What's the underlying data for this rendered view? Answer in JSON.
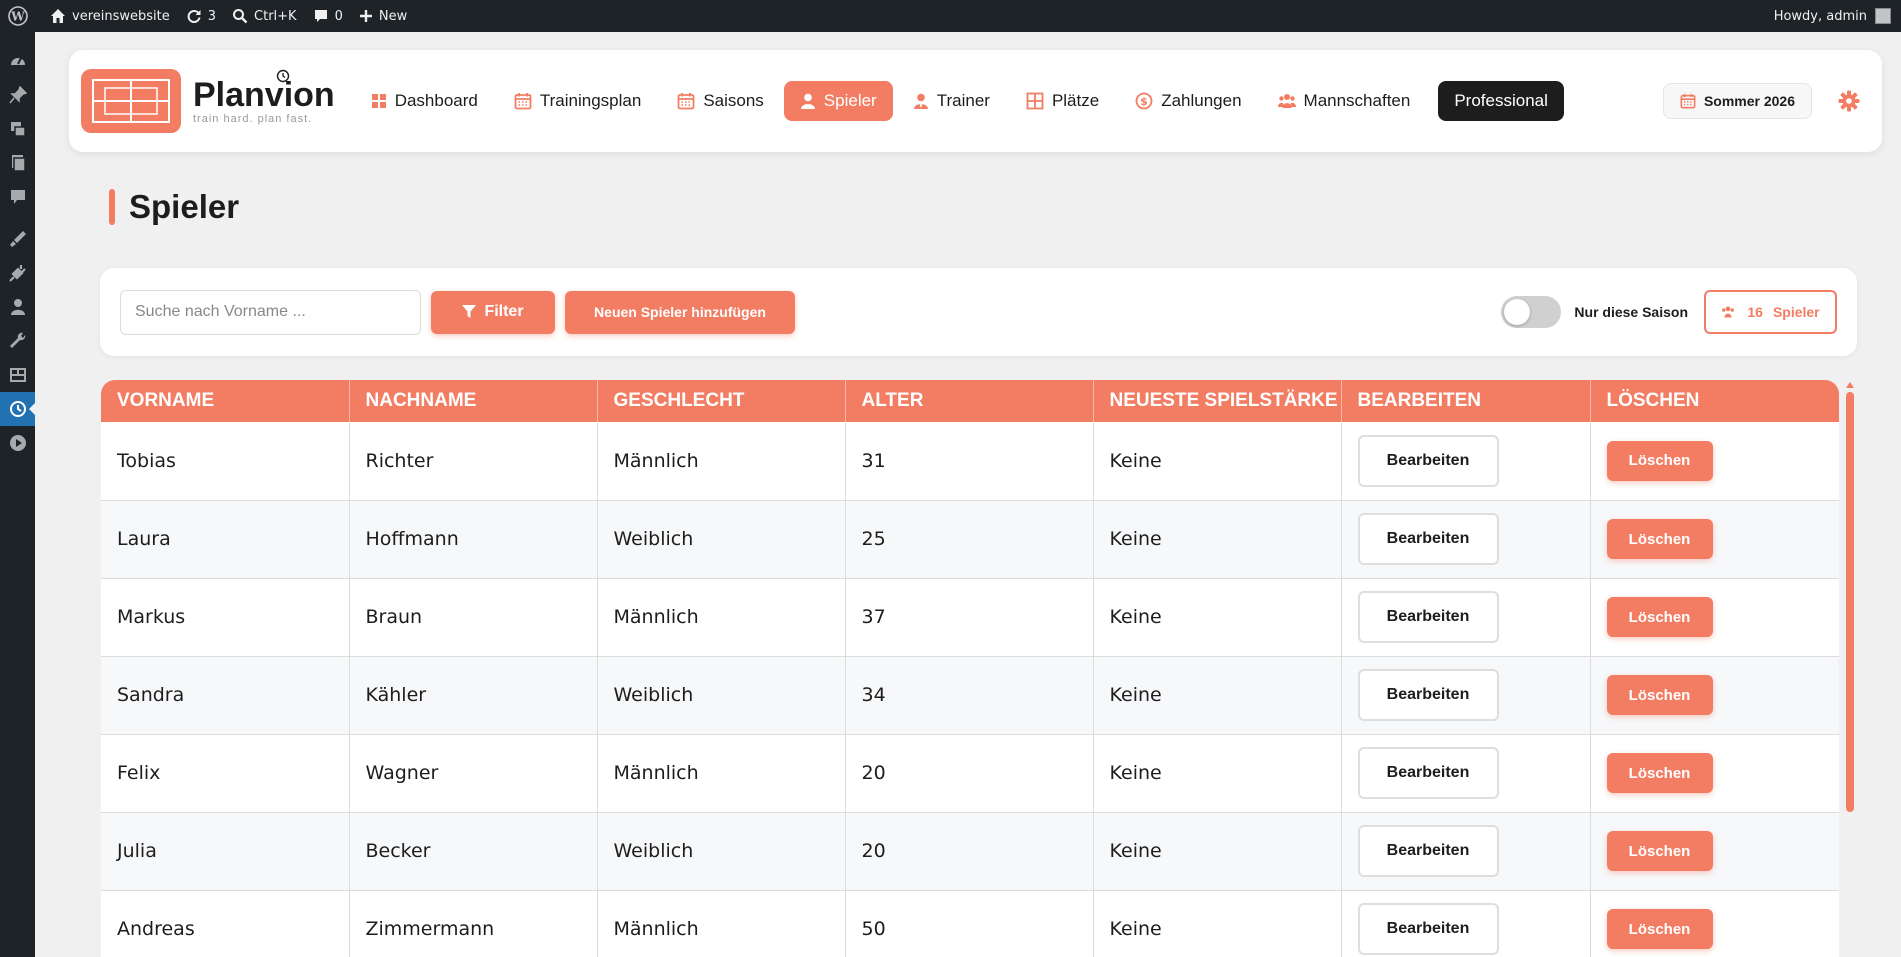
{
  "adminbar": {
    "site_name": "vereinswebsite",
    "updates_count": "3",
    "search_shortcut": "Ctrl+K",
    "comments_count": "0",
    "new_label": "New",
    "howdy": "Howdy, admin"
  },
  "adminmenu": {
    "icons": [
      "dashboard-icon",
      "pin-icon",
      "media-icon",
      "pages-icon",
      "comments-icon",
      "appearance-icon",
      "plugins-icon",
      "users-icon",
      "tools-icon",
      "settings-icon",
      "planvion-icon",
      "play-icon"
    ]
  },
  "app": {
    "brand_name": "Planvion",
    "brand_tagline": "train hard. plan fast.",
    "nav": [
      {
        "label": "Dashboard",
        "icon": "grid-icon"
      },
      {
        "label": "Trainingsplan",
        "icon": "calendar-icon"
      },
      {
        "label": "Saisons",
        "icon": "calendar-icon"
      },
      {
        "label": "Spieler",
        "icon": "user-icon",
        "active": true
      },
      {
        "label": "Trainer",
        "icon": "user-tie-icon"
      },
      {
        "label": "Plätze",
        "icon": "field-icon"
      },
      {
        "label": "Zahlungen",
        "icon": "dollar-icon"
      },
      {
        "label": "Mannschaften",
        "icon": "team-icon"
      }
    ],
    "pro_label": "Professional",
    "season_label": "Sommer 2026"
  },
  "page": {
    "title": "Spieler"
  },
  "toolbar": {
    "search_placeholder": "Suche nach Vorname ...",
    "filter_label": "Filter",
    "add_label": "Neuen Spieler hinzufügen",
    "toggle_label": "Nur diese Saison",
    "toggle_on": false,
    "count": "16",
    "count_label": "Spieler"
  },
  "table": {
    "headers": [
      "VORNAME",
      "NACHNAME",
      "GESCHLECHT",
      "ALTER",
      "NEUESTE SPIELSTÄRKE",
      "BEARBEITEN",
      "LÖSCHEN"
    ],
    "edit_label": "Bearbeiten",
    "delete_label": "Löschen",
    "rows": [
      {
        "vorname": "Tobias",
        "nachname": "Richter",
        "geschlecht": "Männlich",
        "alter": "31",
        "staerke": "Keine"
      },
      {
        "vorname": "Laura",
        "nachname": "Hoffmann",
        "geschlecht": "Weiblich",
        "alter": "25",
        "staerke": "Keine"
      },
      {
        "vorname": "Markus",
        "nachname": "Braun",
        "geschlecht": "Männlich",
        "alter": "37",
        "staerke": "Keine"
      },
      {
        "vorname": "Sandra",
        "nachname": "Kähler",
        "geschlecht": "Weiblich",
        "alter": "34",
        "staerke": "Keine"
      },
      {
        "vorname": "Felix",
        "nachname": "Wagner",
        "geschlecht": "Männlich",
        "alter": "20",
        "staerke": "Keine"
      },
      {
        "vorname": "Julia",
        "nachname": "Becker",
        "geschlecht": "Weiblich",
        "alter": "20",
        "staerke": "Keine"
      },
      {
        "vorname": "Andreas",
        "nachname": "Zimmermann",
        "geschlecht": "Männlich",
        "alter": "50",
        "staerke": "Keine"
      }
    ]
  },
  "colors": {
    "accent": "#f37d63",
    "dark": "#1d1d1d",
    "wp_bar": "#1d2327",
    "wp_active": "#2271b1"
  }
}
